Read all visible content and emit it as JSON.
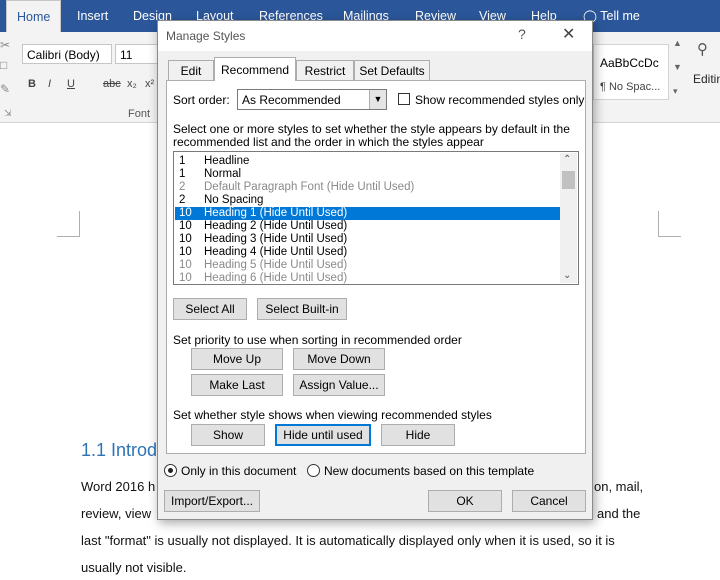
{
  "ribbon": {
    "tabs": [
      "Home",
      "Insert",
      "Design",
      "Layout",
      "References",
      "Mailings",
      "Review",
      "View",
      "Help"
    ],
    "tell_me": "Tell me",
    "font_name": "Calibri (Body)",
    "font_size": "11",
    "font_group_label": "Font",
    "style_preview_sample": "AaBbCcDc",
    "style_preview_name": "¶ No Spac...",
    "editing_label": "Editin",
    "format_bold": "B",
    "format_italic": "I",
    "format_underline": "U",
    "format_strike": "abc",
    "format_sub": "x₂",
    "format_sup": "x²"
  },
  "document": {
    "heading": "1.1 Introd",
    "lines": [
      "Word 2016 h",
      "review, view",
      "last \"format\" is usually not displayed. It is automatically displayed only when it is used, so it is",
      "usually not visible."
    ],
    "right_fragments": [
      "on, mail,",
      "and the"
    ]
  },
  "dialog": {
    "title": "Manage Styles",
    "help": "?",
    "close": "✕",
    "tabs": [
      "Edit",
      "Recommend",
      "Restrict",
      "Set Defaults"
    ],
    "sort_order_label": "Sort order:",
    "sort_order_value": "As Recommended",
    "show_recommended_label": "Show recommended styles only",
    "instruction_line1": "Select one or more styles to set whether the style appears by default in the",
    "instruction_line2": "recommended list and the order in which the styles appear",
    "styles": [
      {
        "priority": "1",
        "name": "Headline",
        "gray": false
      },
      {
        "priority": "1",
        "name": "Normal",
        "gray": false
      },
      {
        "priority": "2",
        "name": "Default Paragraph Font  (Hide Until Used)",
        "gray": true
      },
      {
        "priority": "2",
        "name": "No Spacing",
        "gray": false
      },
      {
        "priority": "10",
        "name": "Heading 1  (Hide Until Used)",
        "gray": false,
        "selected": true
      },
      {
        "priority": "10",
        "name": "Heading 2  (Hide Until Used)",
        "gray": false
      },
      {
        "priority": "10",
        "name": "Heading 3  (Hide Until Used)",
        "gray": false
      },
      {
        "priority": "10",
        "name": "Heading 4  (Hide Until Used)",
        "gray": false
      },
      {
        "priority": "10",
        "name": "Heading 5  (Hide Until Used)",
        "gray": true
      },
      {
        "priority": "10",
        "name": "Heading 6  (Hide Until Used)",
        "gray": true
      }
    ],
    "select_all": "Select All",
    "select_builtin": "Select Built-in",
    "priority_label": "Set priority to use when sorting in recommended order",
    "move_up": "Move Up",
    "move_down": "Move Down",
    "make_last": "Make Last",
    "assign_value": "Assign Value...",
    "visibility_label": "Set whether style shows when viewing recommended styles",
    "show": "Show",
    "hide_until_used": "Hide until used",
    "hide": "Hide",
    "only_this_doc": "Only in this document",
    "new_docs_template": "New documents based on this template",
    "import_export": "Import/Export...",
    "ok": "OK",
    "cancel": "Cancel"
  }
}
